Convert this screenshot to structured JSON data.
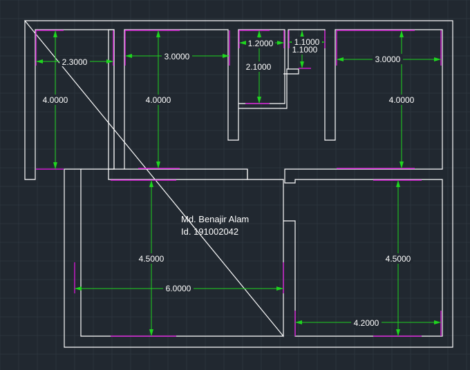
{
  "drawing": {
    "background": "#212830",
    "wall_color": "#ffffff",
    "dimension_color": "#1fd61f",
    "extension_color": "#d11bd1",
    "owner_name": "Md. Benajir Alam",
    "owner_id": "Id. 191002042"
  },
  "dimensions": [
    {
      "id": "room1-width",
      "label": "2.3000"
    },
    {
      "id": "room1-height",
      "label": "4.0000"
    },
    {
      "id": "room2-width",
      "label": "3.0000"
    },
    {
      "id": "room2-height",
      "label": "4.0000"
    },
    {
      "id": "bath-width",
      "label": "1.2000"
    },
    {
      "id": "bath-height",
      "label": "2.1000"
    },
    {
      "id": "closet-width",
      "label": "1.1000"
    },
    {
      "id": "closet-height",
      "label": "1.1000"
    },
    {
      "id": "room3-width",
      "label": "3.0000"
    },
    {
      "id": "room3-height",
      "label": "4.0000"
    },
    {
      "id": "hall-width",
      "label": "6.0000"
    },
    {
      "id": "hall-height",
      "label": "4.5000"
    },
    {
      "id": "room4-width",
      "label": "4.2000"
    },
    {
      "id": "room4-height",
      "label": "4.5000"
    }
  ]
}
